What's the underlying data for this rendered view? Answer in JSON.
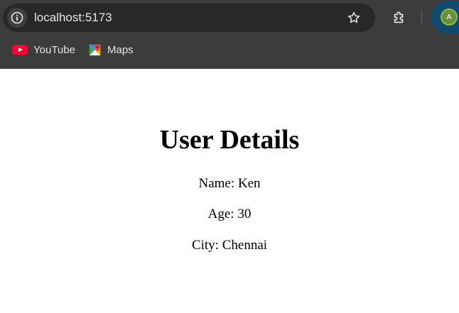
{
  "browser": {
    "url": "localhost:5173",
    "bookmarks": [
      {
        "label": "YouTube",
        "icon": "youtube-icon"
      },
      {
        "label": "Maps",
        "icon": "maps-icon"
      }
    ],
    "profile_initial": "A",
    "colors": {
      "chrome_bg": "#3c3c3c",
      "address_bg": "#282828",
      "profile_bg": "#0f4a6e"
    }
  },
  "page": {
    "title": "User Details",
    "details": {
      "name": "Name: Ken",
      "age": "Age: 30",
      "city": "City: Chennai"
    }
  }
}
